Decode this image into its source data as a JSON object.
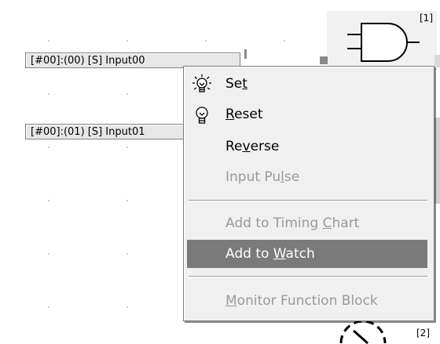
{
  "canvas": {
    "input_blocks": [
      {
        "label": "[#00]:(00) [S] Input00"
      },
      {
        "label": "[#00]:(01) [S] Input01"
      }
    ],
    "gates": [
      {
        "number": "[1]",
        "icon": "and-gate-icon"
      },
      {
        "number": "[2]",
        "icon": "function-block-icon"
      }
    ]
  },
  "context_menu": {
    "items": [
      {
        "label": "Set",
        "mnemonic": "t",
        "icon": "bulb-on-icon",
        "enabled": true,
        "highlighted": false
      },
      {
        "label": "Reset",
        "mnemonic": "R",
        "icon": "bulb-off-icon",
        "enabled": true,
        "highlighted": false
      },
      {
        "label": "Reverse",
        "mnemonic": "v",
        "icon": null,
        "enabled": true,
        "highlighted": false
      },
      {
        "label": "Input Pulse",
        "mnemonic": "l",
        "icon": null,
        "enabled": false,
        "highlighted": false
      },
      {
        "label": "Add to Timing Chart",
        "mnemonic": "C",
        "icon": null,
        "enabled": false,
        "highlighted": false
      },
      {
        "label": "Add to Watch",
        "mnemonic": "W",
        "icon": null,
        "enabled": true,
        "highlighted": true
      },
      {
        "label": "Monitor Function Block",
        "mnemonic": "M",
        "icon": null,
        "enabled": false,
        "highlighted": false
      }
    ]
  },
  "colors": {
    "menu_background": "#f0f0f0",
    "menu_highlight": "#7a7a7a",
    "disabled_text": "#9a9a9a",
    "input_block_background": "#e7e7e7"
  }
}
